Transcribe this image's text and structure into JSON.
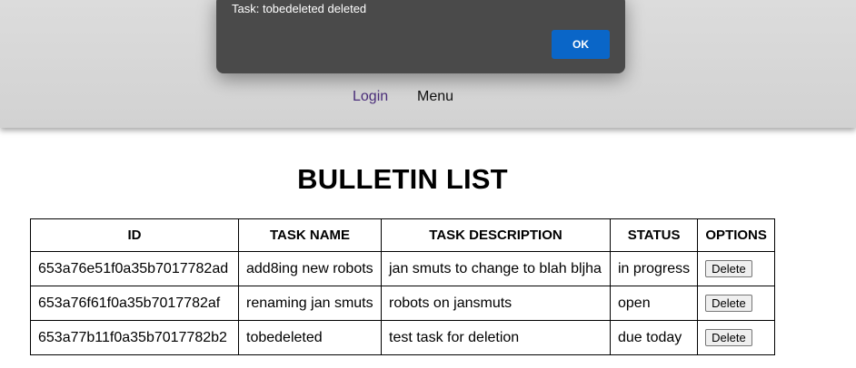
{
  "dialog": {
    "message": "Task: tobedeleted deleted",
    "ok_label": "OK"
  },
  "nav": {
    "login": "Login",
    "menu": "Menu"
  },
  "page": {
    "title": "BULLETIN LIST"
  },
  "table": {
    "headers": [
      "ID",
      "TASK NAME",
      "TASK DESCRIPTION",
      "STATUS",
      "OPTIONS"
    ],
    "rows": [
      {
        "id": "653a76e51f0a35b7017782ad",
        "name": "add8ing new robots",
        "description": "jan smuts to change to blah bljha",
        "status": "in progress",
        "action": "Delete"
      },
      {
        "id": "653a76f61f0a35b7017782af",
        "name": "renaming jan smuts",
        "description": "robots on jansmuts",
        "status": "open",
        "action": "Delete"
      },
      {
        "id": "653a77b11f0a35b7017782b2",
        "name": "tobedeleted",
        "description": "test task for deletion",
        "status": "due today",
        "action": "Delete"
      }
    ]
  },
  "colors": {
    "dialog_bg": "#4a4a4a",
    "ok_button": "#0a66c8",
    "login_link": "#4a2d7a",
    "header_bg": "#d6d6d6"
  }
}
